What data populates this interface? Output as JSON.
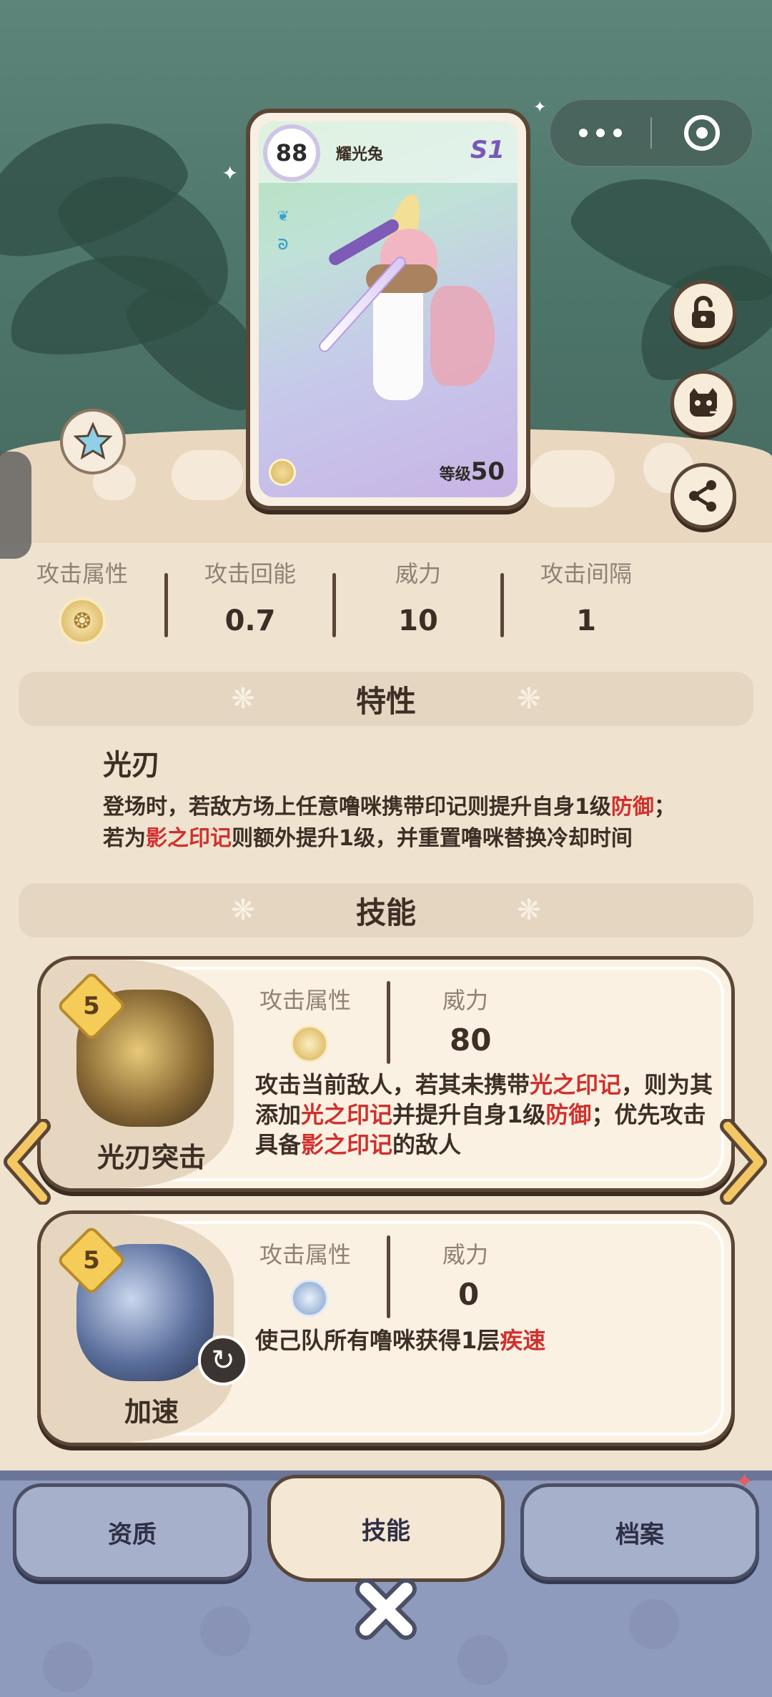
{
  "card": {
    "level": "88",
    "name": "耀光兔",
    "season": "S1",
    "level_label": "等级",
    "level_value": "50"
  },
  "stats": [
    {
      "label": "攻击属性",
      "value": ""
    },
    {
      "label": "攻击回能",
      "value": "0.7"
    },
    {
      "label": "威力",
      "value": "10"
    },
    {
      "label": "攻击间隔",
      "value": "1"
    }
  ],
  "trait_section": {
    "title": "特性"
  },
  "trait": {
    "name": "光刃",
    "desc_parts": [
      "登场时，若敌方场上任意噜咪携带印记则提升自身1级",
      "防御",
      "；若为",
      "影之印记",
      "则额外提升1级，并重置噜咪替换冷却时间"
    ]
  },
  "skill_section": {
    "title": "技能"
  },
  "skills": [
    {
      "badge": "5",
      "name": "光刃突击",
      "attr_label": "攻击属性",
      "power_label": "威力",
      "power_value": "80",
      "desc_parts": [
        "攻击当前敌人，若其未携带",
        "光之印记",
        "，则为其添加",
        "光之印记",
        "并提升自身1级",
        "防御",
        "；优先攻击具备",
        "影之印记",
        "的敌人"
      ]
    },
    {
      "badge": "5",
      "name": "加速",
      "attr_label": "攻击属性",
      "power_label": "威力",
      "power_value": "0",
      "desc_parts": [
        "使己队所有噜咪获得1层",
        "疾速"
      ]
    }
  ],
  "tabs": [
    {
      "label": "资质"
    },
    {
      "label": "技能"
    },
    {
      "label": "档案"
    }
  ],
  "icons": {
    "lock": "unlock-icon",
    "swap": "cat-swap-icon",
    "share": "share-icon",
    "star": "star-icon",
    "close": "close-icon"
  },
  "colors": {
    "accent_red": "#d0312d",
    "brown": "#5b4636",
    "bottom_bar": "#8f9bbd"
  }
}
